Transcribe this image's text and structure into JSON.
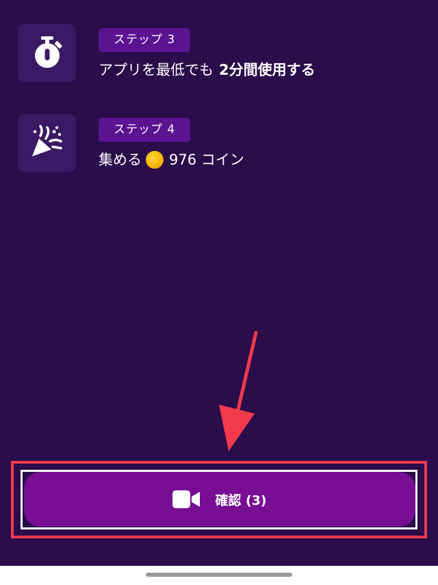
{
  "steps": [
    {
      "badge": "ステップ 3",
      "text": "アプリを最低でも",
      "emphasis": "2分間使用する",
      "icon": "stopwatch-icon"
    },
    {
      "badge": "ステップ 4",
      "text": "集める",
      "amount": "976 コイン",
      "icon": "party-popper-icon",
      "coin_icon": "coin-icon"
    }
  ],
  "confirm_button": {
    "label": "確認 (3)",
    "icon": "video-camera-icon"
  },
  "colors": {
    "background": "#2a0d4a",
    "tile": "#3c1964",
    "badge": "#5b1391",
    "button": "#770e93",
    "annotation": "#f23a4c",
    "coin": "#f5b800"
  }
}
